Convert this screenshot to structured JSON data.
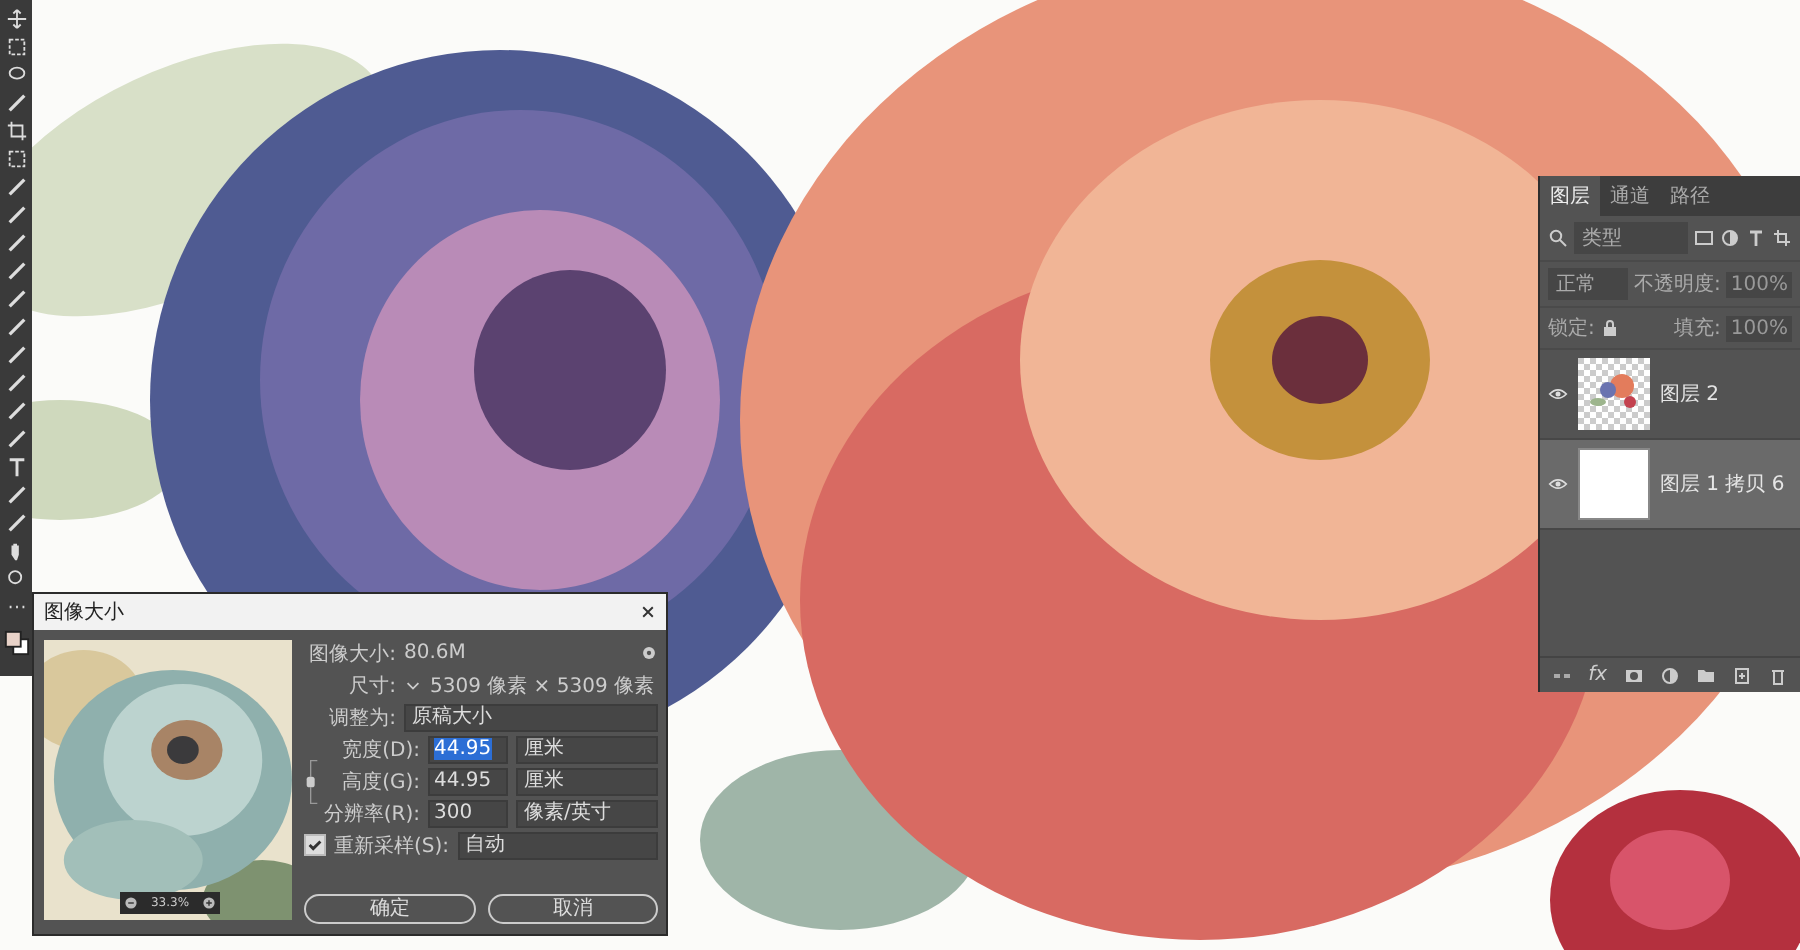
{
  "layers_panel": {
    "tabs": [
      {
        "label": "图层",
        "selected": true
      },
      {
        "label": "通道",
        "selected": false
      },
      {
        "label": "路径",
        "selected": false
      }
    ],
    "filter_kind": "类型",
    "blend_mode": "正常",
    "opacity_label": "不透明度:",
    "opacity": "100%",
    "lock_label": "锁定:",
    "fill_label": "填充:",
    "fill": "100%",
    "layers": [
      {
        "name": "图层 2",
        "visible": true,
        "selected": false,
        "kind": "picture"
      },
      {
        "name": "图层 1 拷贝 6",
        "visible": true,
        "selected": true,
        "kind": "blank"
      }
    ],
    "fx_label": "fx"
  },
  "dialog": {
    "title": "图像大小",
    "zoom": "33.3%",
    "image_size_label": "图像大小:",
    "image_size": "80.6M",
    "dimensions_label": "尺寸:",
    "dimensions": "5309 像素 × 5309 像素",
    "fit_label": "调整为:",
    "fit": "原稿大小",
    "fields": [
      {
        "label": "宽度(D):",
        "value": "44.95",
        "unit": "厘米",
        "selected": true
      },
      {
        "label": "高度(G):",
        "value": "44.95",
        "unit": "厘米",
        "selected": false
      },
      {
        "label": "分辨率(R):",
        "value": "300",
        "unit": "像素/英寸",
        "selected": false
      }
    ],
    "resample": {
      "label": "重新采样(S):",
      "checked": true,
      "value": "自动"
    },
    "buttons": [
      "确定",
      "取消"
    ]
  }
}
